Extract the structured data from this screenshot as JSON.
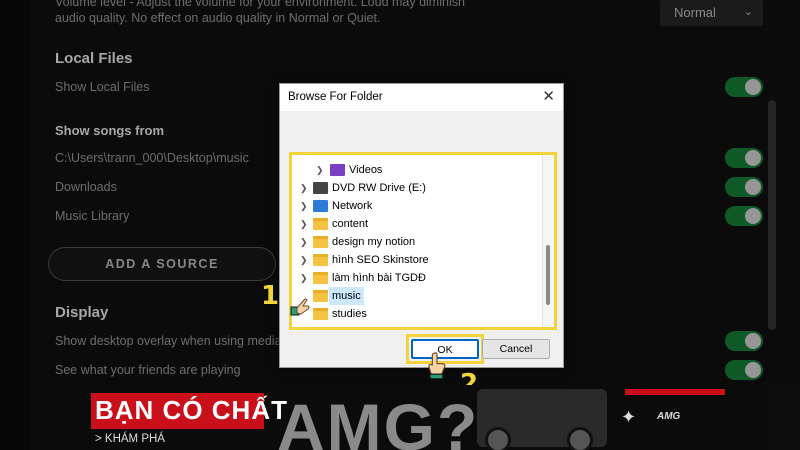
{
  "settings": {
    "volume_desc_line1": "Volume level - Adjust the volume for your environment. Loud may diminish",
    "volume_desc_line2": "audio quality. No effect on audio quality in Normal or Quiet.",
    "volume_value": "Normal",
    "local_files_heading": "Local Files",
    "show_local_files": "Show Local Files",
    "show_songs_from": "Show songs from",
    "sources": [
      "C:\\Users\\trann_000\\Desktop\\music",
      "Downloads",
      "Music Library"
    ],
    "add_source": "ADD A SOURCE",
    "display_heading": "Display",
    "desktop_overlay": "Show desktop overlay when using media keys",
    "friends_playing": "See what your friends are playing"
  },
  "dialog": {
    "title": "Browse For Folder",
    "close_glyph": "✕",
    "items": [
      {
        "label": "Videos",
        "icon": "videos-folder-icon"
      },
      {
        "label": "DVD RW Drive (E:)",
        "icon": "dvd-drive-icon"
      },
      {
        "label": "Network",
        "icon": "network-icon"
      },
      {
        "label": "content",
        "icon": "folder-icon"
      },
      {
        "label": "design my notion",
        "icon": "folder-icon"
      },
      {
        "label": "hình SEO Skinstore",
        "icon": "folder-icon"
      },
      {
        "label": "làm hình bài TGDĐ",
        "icon": "folder-icon"
      },
      {
        "label": "music",
        "icon": "folder-icon",
        "selected": true
      },
      {
        "label": "studies",
        "icon": "folder-icon"
      }
    ],
    "ok_label": "OK",
    "cancel_label": "Cancel"
  },
  "annotations": {
    "step1": "1",
    "step2": "2",
    "highlight_color": "#f2d43a"
  },
  "ad": {
    "headline": "BẠN CÓ CHẤT",
    "big_text": "AMG?",
    "cta": "> KHÁM PHÁ",
    "brand": "AMG"
  },
  "colors": {
    "toggle_on": "#1a8a3e",
    "background": "#121212",
    "ad_red": "#c9101a"
  }
}
